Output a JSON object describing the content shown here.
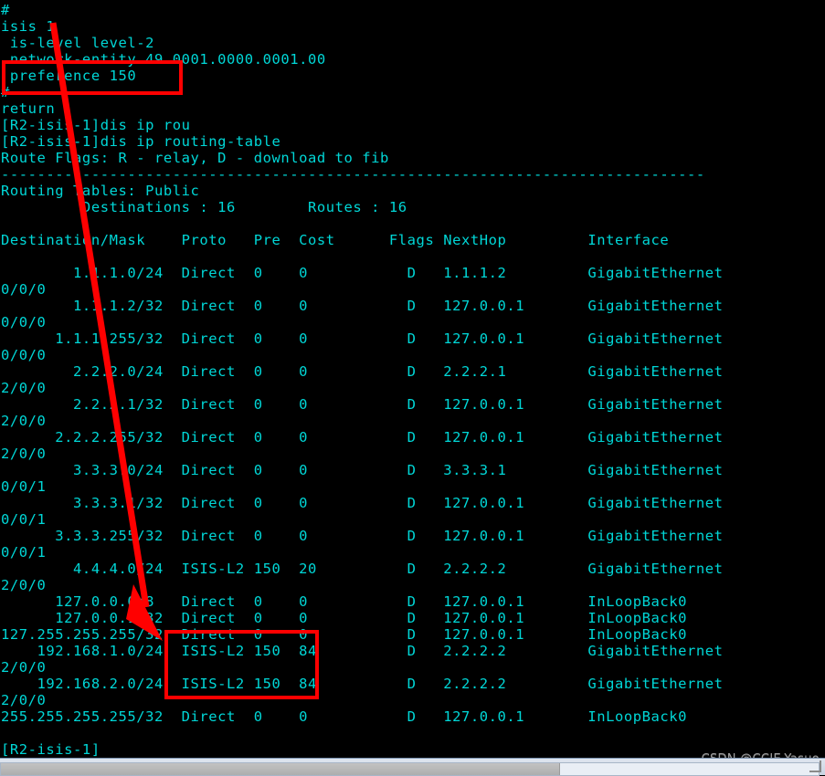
{
  "terminal": {
    "text_color": "#00d7d7",
    "background_color": "#000000",
    "lines": [
      "#",
      "isis 1",
      " is-level level-2",
      " network-entity 49.0001.0000.0001.00",
      " preference 150",
      "#",
      "return",
      "[R2-isis-1]dis ip rou",
      "[R2-isis-1]dis ip routing-table",
      "Route Flags: R - relay, D - download to fib",
      "------------------------------------------------------------------------------",
      "Routing Tables: Public",
      "         Destinations : 16        Routes : 16",
      "",
      "Destination/Mask    Proto   Pre  Cost      Flags NextHop         Interface",
      "",
      "        1.1.1.0/24  Direct  0    0           D   1.1.1.2         GigabitEthernet",
      "0/0/0",
      "        1.1.1.2/32  Direct  0    0           D   127.0.0.1       GigabitEthernet",
      "0/0/0",
      "      1.1.1.255/32  Direct  0    0           D   127.0.0.1       GigabitEthernet",
      "0/0/0",
      "        2.2.2.0/24  Direct  0    0           D   2.2.2.1         GigabitEthernet",
      "2/0/0",
      "        2.2.2.1/32  Direct  0    0           D   127.0.0.1       GigabitEthernet",
      "2/0/0",
      "      2.2.2.255/32  Direct  0    0           D   127.0.0.1       GigabitEthernet",
      "2/0/0",
      "        3.3.3.0/24  Direct  0    0           D   3.3.3.1         GigabitEthernet",
      "0/0/1",
      "        3.3.3.1/32  Direct  0    0           D   127.0.0.1       GigabitEthernet",
      "0/0/1",
      "      3.3.3.255/32  Direct  0    0           D   127.0.0.1       GigabitEthernet",
      "0/0/1",
      "        4.4.4.0/24  ISIS-L2 150  20          D   2.2.2.2         GigabitEthernet",
      "2/0/0",
      "      127.0.0.0/8   Direct  0    0           D   127.0.0.1       InLoopBack0",
      "      127.0.0.1/32  Direct  0    0           D   127.0.0.1       InLoopBack0",
      "127.255.255.255/32  Direct  0    0           D   127.0.0.1       InLoopBack0",
      "    192.168.1.0/24  ISIS-L2 150  84          D   2.2.2.2         GigabitEthernet",
      "2/0/0",
      "    192.168.2.0/24  ISIS-L2 150  84          D   2.2.2.2         GigabitEthernet",
      "2/0/0",
      "255.255.255.255/32  Direct  0    0           D   127.0.0.1       InLoopBack0",
      "",
      "[R2-isis-1]"
    ]
  },
  "routing_table": {
    "route_flags_legend": "Route Flags: R - relay, D - download to fib",
    "tables_label": "Routing Tables: Public",
    "destinations_label": "Destinations",
    "destinations_count": "16",
    "routes_label": "Routes",
    "routes_count": "16",
    "columns": [
      "Destination/Mask",
      "Proto",
      "Pre",
      "Cost",
      "Flags",
      "NextHop",
      "Interface"
    ],
    "rows": [
      {
        "dest": "1.1.1.0/24",
        "proto": "Direct",
        "pre": "0",
        "cost": "0",
        "flags": "D",
        "nexthop": "1.1.1.2",
        "interface": "GigabitEthernet0/0/0"
      },
      {
        "dest": "1.1.1.2/32",
        "proto": "Direct",
        "pre": "0",
        "cost": "0",
        "flags": "D",
        "nexthop": "127.0.0.1",
        "interface": "GigabitEthernet0/0/0"
      },
      {
        "dest": "1.1.1.255/32",
        "proto": "Direct",
        "pre": "0",
        "cost": "0",
        "flags": "D",
        "nexthop": "127.0.0.1",
        "interface": "GigabitEthernet0/0/0"
      },
      {
        "dest": "2.2.2.0/24",
        "proto": "Direct",
        "pre": "0",
        "cost": "0",
        "flags": "D",
        "nexthop": "2.2.2.1",
        "interface": "GigabitEthernet2/0/0"
      },
      {
        "dest": "2.2.2.1/32",
        "proto": "Direct",
        "pre": "0",
        "cost": "0",
        "flags": "D",
        "nexthop": "127.0.0.1",
        "interface": "GigabitEthernet2/0/0"
      },
      {
        "dest": "2.2.2.255/32",
        "proto": "Direct",
        "pre": "0",
        "cost": "0",
        "flags": "D",
        "nexthop": "127.0.0.1",
        "interface": "GigabitEthernet2/0/0"
      },
      {
        "dest": "3.3.3.0/24",
        "proto": "Direct",
        "pre": "0",
        "cost": "0",
        "flags": "D",
        "nexthop": "3.3.3.1",
        "interface": "GigabitEthernet0/0/1"
      },
      {
        "dest": "3.3.3.1/32",
        "proto": "Direct",
        "pre": "0",
        "cost": "0",
        "flags": "D",
        "nexthop": "127.0.0.1",
        "interface": "GigabitEthernet0/0/1"
      },
      {
        "dest": "3.3.3.255/32",
        "proto": "Direct",
        "pre": "0",
        "cost": "0",
        "flags": "D",
        "nexthop": "127.0.0.1",
        "interface": "GigabitEthernet0/0/1"
      },
      {
        "dest": "4.4.4.0/24",
        "proto": "ISIS-L2",
        "pre": "150",
        "cost": "20",
        "flags": "D",
        "nexthop": "2.2.2.2",
        "interface": "GigabitEthernet2/0/0"
      },
      {
        "dest": "127.0.0.0/8",
        "proto": "Direct",
        "pre": "0",
        "cost": "0",
        "flags": "D",
        "nexthop": "127.0.0.1",
        "interface": "InLoopBack0"
      },
      {
        "dest": "127.0.0.1/32",
        "proto": "Direct",
        "pre": "0",
        "cost": "0",
        "flags": "D",
        "nexthop": "127.0.0.1",
        "interface": "InLoopBack0"
      },
      {
        "dest": "127.255.255.255/32",
        "proto": "Direct",
        "pre": "0",
        "cost": "0",
        "flags": "D",
        "nexthop": "127.0.0.1",
        "interface": "InLoopBack0"
      },
      {
        "dest": "192.168.1.0/24",
        "proto": "ISIS-L2",
        "pre": "150",
        "cost": "84",
        "flags": "D",
        "nexthop": "2.2.2.2",
        "interface": "GigabitEthernet2/0/0"
      },
      {
        "dest": "192.168.2.0/24",
        "proto": "ISIS-L2",
        "pre": "150",
        "cost": "84",
        "flags": "D",
        "nexthop": "2.2.2.2",
        "interface": "GigabitEthernet2/0/0"
      },
      {
        "dest": "255.255.255.255/32",
        "proto": "Direct",
        "pre": "0",
        "cost": "0",
        "flags": "D",
        "nexthop": "127.0.0.1",
        "interface": "InLoopBack0"
      }
    ]
  },
  "config": {
    "isis_process": "isis 1",
    "is_level": " is-level level-2",
    "network_entity": " network-entity 49.0001.0000.0001.00",
    "preference": " preference 150"
  },
  "commands": [
    "[R2-isis-1]dis ip rou",
    "[R2-isis-1]dis ip routing-table"
  ],
  "prompt": "[R2-isis-1]",
  "annotations": {
    "color": "#ff0000",
    "box_preference_target": " preference 150",
    "box_cost_target": "ISIS-L2 150 84",
    "arrow_from": " preference 150",
    "arrow_to": "ISIS-L2 150 84"
  },
  "watermark": "CSDN @CCIE-Yasuo"
}
